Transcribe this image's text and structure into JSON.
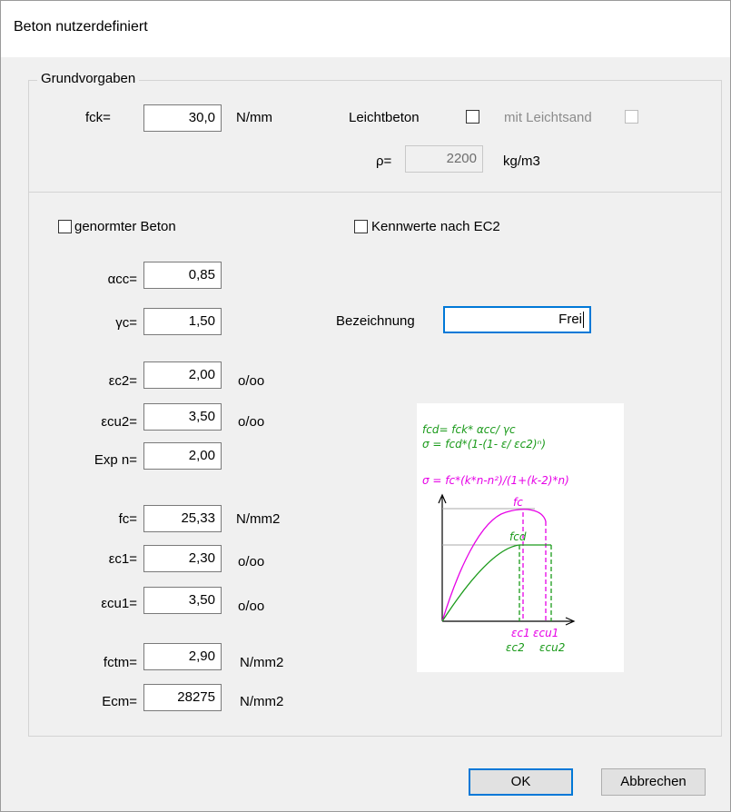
{
  "window": {
    "title": "Beton nutzerdefiniert"
  },
  "grundvorgaben": {
    "legend": "Grundvorgaben",
    "fck_label": "fck=",
    "fck_value": "30,0",
    "fck_unit": "N/mm",
    "leichtbeton_label": "Leichtbeton",
    "leichtbeton_checked": false,
    "mit_leichtsand_label": "mit Leichtsand",
    "mit_leichtsand_checked": false,
    "rho_label": "ρ=",
    "rho_value": "2200",
    "rho_unit": "kg/m3"
  },
  "params": {
    "genormter_beton_label": "genormter Beton",
    "genormter_beton_checked": false,
    "kennwerte_label": "Kennwerte nach EC2",
    "kennwerte_checked": false,
    "alpha_cc_label": "αcc=",
    "alpha_cc_value": "0,85",
    "gamma_c_label": "γc=",
    "gamma_c_value": "1,50",
    "bezeichnung_label": "Bezeichnung",
    "bezeichnung_value": "Frei",
    "eps_c2_label": "εc2=",
    "eps_c2_value": "2,00",
    "eps_c2_unit": "o/oo",
    "eps_cu2_label": "εcu2=",
    "eps_cu2_value": "3,50",
    "eps_cu2_unit": "o/oo",
    "exp_n_label": "Exp n=",
    "exp_n_value": "2,00",
    "fc_label": "fc=",
    "fc_value": "25,33",
    "fc_unit": "N/mm2",
    "eps_c1_label": "εc1=",
    "eps_c1_value": "2,30",
    "eps_c1_unit": "o/oo",
    "eps_cu1_label": "εcu1=",
    "eps_cu1_value": "3,50",
    "eps_cu1_unit": "o/oo",
    "fctm_label": "fctm=",
    "fctm_value": "2,90",
    "fctm_unit": "N/mm2",
    "ecm_label": "Ecm=",
    "ecm_value": "28275",
    "ecm_unit": "N/mm2"
  },
  "diagram": {
    "formula1": "fcd= fck* αcc/ γc",
    "formula2": "σ = fcd*(1-(1- ε/ εc2)ⁿ)",
    "formula3": "σ = fc*(k*n-n²)/(1+(k-2)*n)",
    "fc_label": "fc",
    "fcd_label": "fcd",
    "ec1_label": "εc1",
    "ecu1_label": "εcu1",
    "ec2_label": "εc2",
    "ecu2_label": "εcu2",
    "colors": {
      "magenta": "#e600e6",
      "green": "#1a9a1a"
    }
  },
  "buttons": {
    "ok": "OK",
    "cancel": "Abbrechen"
  }
}
